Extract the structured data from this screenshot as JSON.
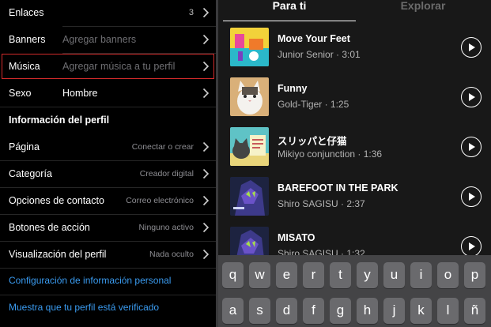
{
  "profile_edit": {
    "enlaces": {
      "label": "Enlaces",
      "count": "3"
    },
    "banners": {
      "label": "Banners",
      "placeholder": "Agregar banners"
    },
    "musica": {
      "label": "Música",
      "placeholder": "Agregar música a tu perfil"
    },
    "sexo": {
      "label": "Sexo",
      "value": "Hombre"
    },
    "section_title": "Información del perfil",
    "pagina": {
      "label": "Página",
      "value": "Conectar o crear"
    },
    "categoria": {
      "label": "Categoría",
      "value": "Creador digital"
    },
    "contacto": {
      "label": "Opciones de contacto",
      "value": "Correo electrónico"
    },
    "botones": {
      "label": "Botones de acción",
      "value": "Ninguno activo"
    },
    "visualizacion": {
      "label": "Visualización del perfil",
      "value": "Nada oculto"
    },
    "link_personal": "Configuración de información personal",
    "link_verificado": "Muestra que tu perfil está verificado"
  },
  "music_picker": {
    "tabs": [
      "Para ti",
      "Explorar"
    ],
    "songs": [
      {
        "title": "Move Your Feet",
        "meta": "Junior Senior · 3:01"
      },
      {
        "title": "Funny",
        "meta": "Gold-Tiger · 1:25"
      },
      {
        "title": "スリッパと仔猫",
        "meta": "Mikiyo conjunction · 1:36"
      },
      {
        "title": "BAREFOOT IN THE PARK",
        "meta": "Shiro SAGISU · 2:37"
      },
      {
        "title": "MISATO",
        "meta": "Shiro SAGISU · 1:32"
      }
    ]
  },
  "keyboard": {
    "row1": [
      "q",
      "w",
      "e",
      "r",
      "t",
      "y",
      "u",
      "i",
      "o",
      "p"
    ],
    "row2": [
      "a",
      "s",
      "d",
      "f",
      "g",
      "h",
      "j",
      "k",
      "l",
      "ñ"
    ]
  },
  "colors": {
    "highlight": "#d12a2a",
    "link": "#3a9bf0",
    "right_bg": "#181818"
  }
}
